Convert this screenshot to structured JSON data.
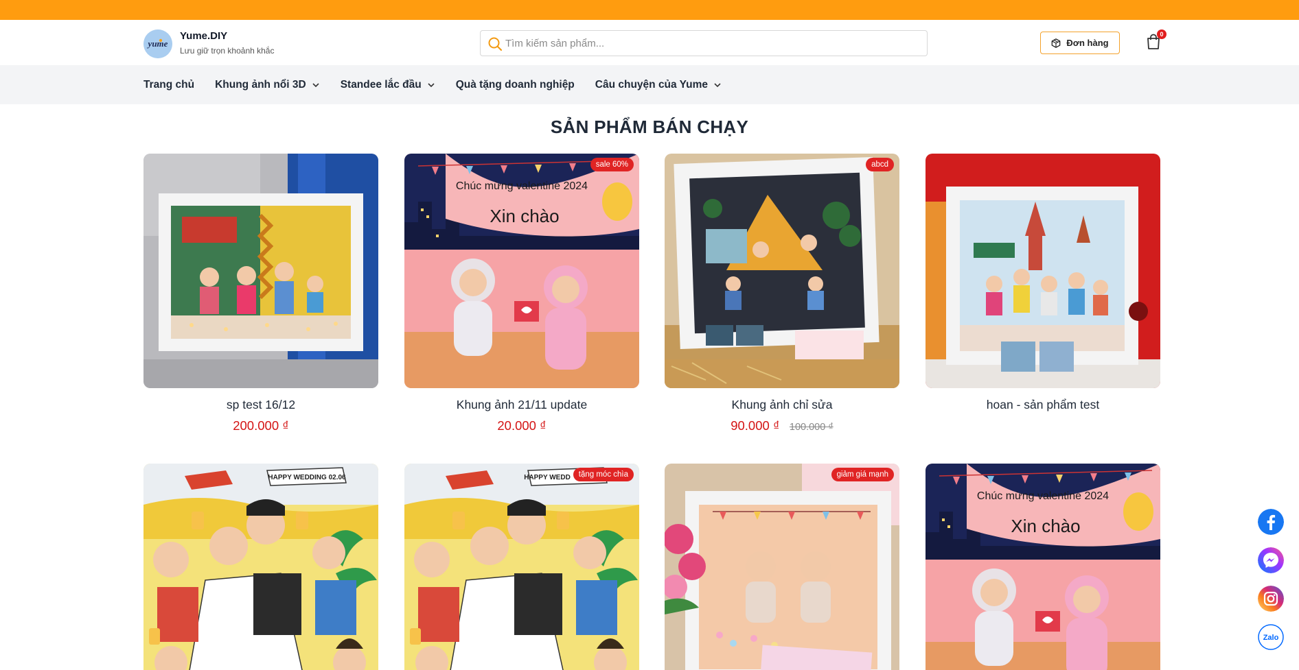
{
  "brand": {
    "name": "Yume.DIY",
    "tagline": "Lưu giữ trọn khoảnh khắc",
    "logo_text": "yume"
  },
  "search": {
    "placeholder": "Tìm kiếm sản phẩm..."
  },
  "header": {
    "orders_label": "Đơn hàng",
    "cart_count": "0"
  },
  "nav": {
    "items": [
      {
        "label": "Trang chủ",
        "has_dropdown": false
      },
      {
        "label": "Khung ảnh nổi 3D",
        "has_dropdown": true
      },
      {
        "label": "Standee lắc đầu",
        "has_dropdown": true
      },
      {
        "label": "Quà tặng doanh nghiệp",
        "has_dropdown": false
      },
      {
        "label": "Câu chuyện của Yume",
        "has_dropdown": true
      }
    ]
  },
  "section": {
    "title": "SẢN PHẨM BÁN CHẠY"
  },
  "products": [
    {
      "name": "sp test 16/12",
      "price": "200.000 ₫",
      "old_price": "",
      "badge": "",
      "image": "frame-family-photo"
    },
    {
      "name": "Khung ảnh 21/11 update",
      "price": "20.000 ₫",
      "old_price": "",
      "badge": "sale 60%",
      "image": "valentine-card",
      "image_texts": {
        "line1": "Chúc mừng valentine 2024",
        "line2": "Xin chào"
      }
    },
    {
      "name": "Khung ảnh chỉ sửa",
      "price": "90.000 ₫",
      "old_price": "100.000 ₫",
      "badge": "abcd",
      "image": "frame-camping-photo"
    },
    {
      "name": "hoan - sản phẩm test",
      "price": "",
      "old_price": "",
      "badge": "",
      "image": "frame-city-photo"
    },
    {
      "name": "",
      "price": "",
      "old_price": "",
      "badge": "",
      "image": "wedding-cartoon",
      "image_texts": {
        "banner": "HAPPY WEDDING 02.06"
      }
    },
    {
      "name": "",
      "price": "",
      "old_price": "",
      "badge": "tặng móc chìa",
      "image": "wedding-cartoon",
      "image_texts": {
        "banner": "HAPPY WEDD"
      }
    },
    {
      "name": "",
      "price": "",
      "old_price": "",
      "badge": "giảm giá mạnh",
      "image": "frame-valentine-photo"
    },
    {
      "name": "",
      "price": "",
      "old_price": "",
      "badge": "",
      "image": "valentine-card",
      "image_texts": {
        "line1": "Chúc mừng valentine 2024",
        "line2": "Xin chào"
      }
    }
  ],
  "social": [
    {
      "name": "facebook",
      "color": "#1877f2"
    },
    {
      "name": "messenger",
      "color": "#7b5cf5"
    },
    {
      "name": "instagram",
      "color": "#d62976"
    },
    {
      "name": "zalo",
      "color": "#0068ff",
      "label": "Zalo"
    }
  ],
  "colors": {
    "accent": "#ff9c0f",
    "price": "#d41414",
    "badge": "#e02424"
  }
}
